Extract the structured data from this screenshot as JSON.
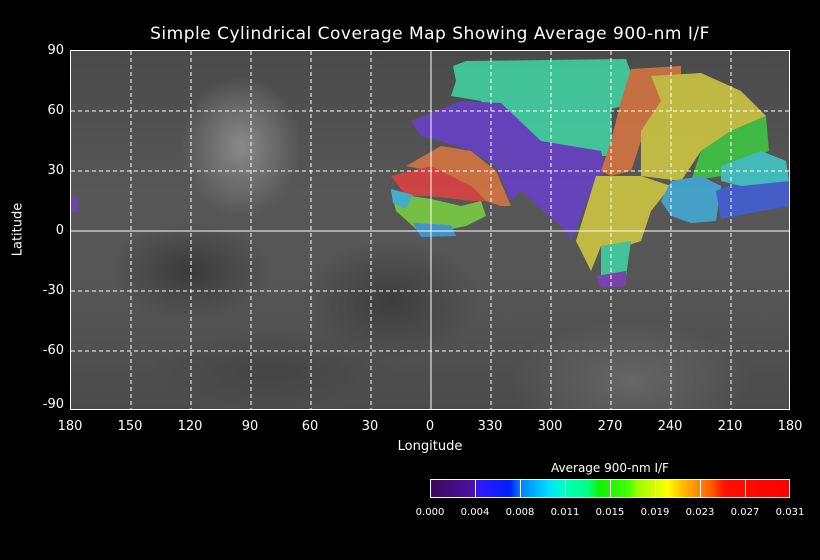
{
  "title": "Simple Cylindrical Coverage Map Showing Average 900-nm I/F",
  "y_axis": {
    "label": "Latitude",
    "ticks": [
      "90",
      "60",
      "30",
      "0",
      "-30",
      "-60",
      "-90"
    ],
    "range": [
      -90,
      90
    ]
  },
  "x_axis": {
    "label": "Longitude",
    "ticks": [
      "180",
      "150",
      "120",
      "90",
      "60",
      "30",
      "0",
      "330",
      "300",
      "270",
      "240",
      "210",
      "180"
    ]
  },
  "colorbar": {
    "title": "Average 900-nm I/F",
    "ticks": [
      "0.000",
      "0.004",
      "0.008",
      "0.011",
      "0.015",
      "0.019",
      "0.023",
      "0.027",
      "0.031"
    ],
    "range": [
      0.0,
      0.031
    ]
  },
  "colors": {
    "purple": "#6a3fd0",
    "teal": "#3fdca8",
    "orange": "#e07840",
    "red": "#e84040",
    "yellow": "#d8d040",
    "green": "#3cd040",
    "cyan": "#40c0e0",
    "blue": "#4060e0",
    "lime": "#a0e040"
  }
}
